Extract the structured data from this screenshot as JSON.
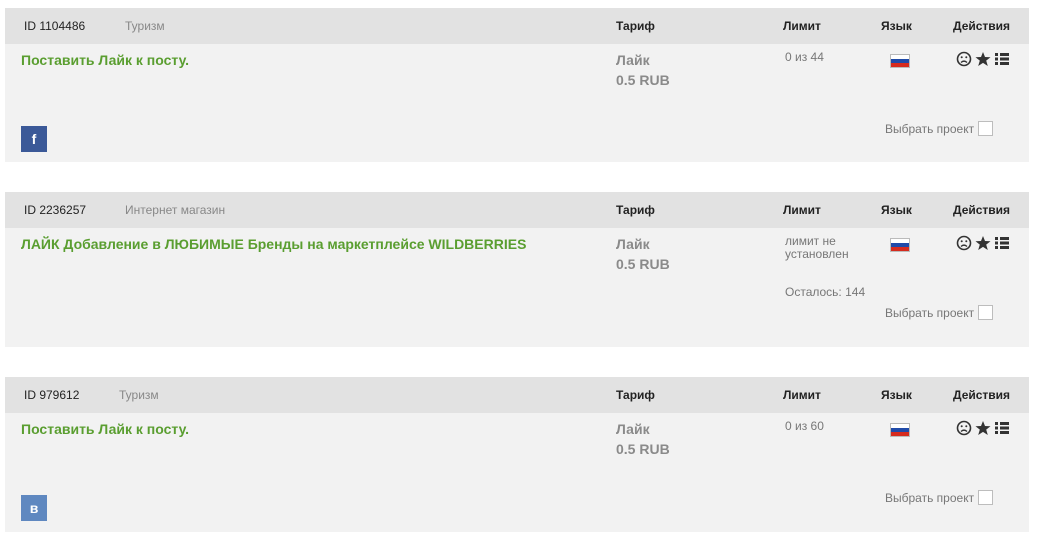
{
  "header_labels": {
    "tarif": "Тариф",
    "limit": "Лимит",
    "lang": "Язык",
    "actions": "Действия"
  },
  "select_project_label": "Выбрать проект",
  "tasks": [
    {
      "id": "ID 1104486",
      "category": "Туризм",
      "title": "Поставить Лайк к посту.",
      "rate_name": "Лайк",
      "rate_price": "0.5 RUB",
      "limit": "0 из 44",
      "remaining": "",
      "social": "f",
      "language": "ru-flag"
    },
    {
      "id": "ID 2236257",
      "category": "Интернет магазин",
      "title": "ЛАЙК Добавление в ЛЮБИМЫЕ Бренды на маркетплейсе WILDBERRIES",
      "rate_name": "Лайк",
      "rate_price": "0.5 RUB",
      "limit": "лимит не установлен",
      "remaining": "Осталось: 144",
      "social": "",
      "language": "ru-flag"
    },
    {
      "id": "ID 979612",
      "category": "Туризм",
      "title": "Поставить Лайк к посту.",
      "rate_name": "Лайк",
      "rate_price": "0.5 RUB",
      "limit": "0 из 60",
      "remaining": "",
      "social": "в",
      "language": "ru-flag"
    }
  ],
  "icons": {
    "frown": "frown-icon",
    "star": "star-icon",
    "list": "list-icon"
  },
  "colors": {
    "title_green": "#5a9e30",
    "facebook": "#3b5998",
    "vk": "#5f88c0"
  }
}
